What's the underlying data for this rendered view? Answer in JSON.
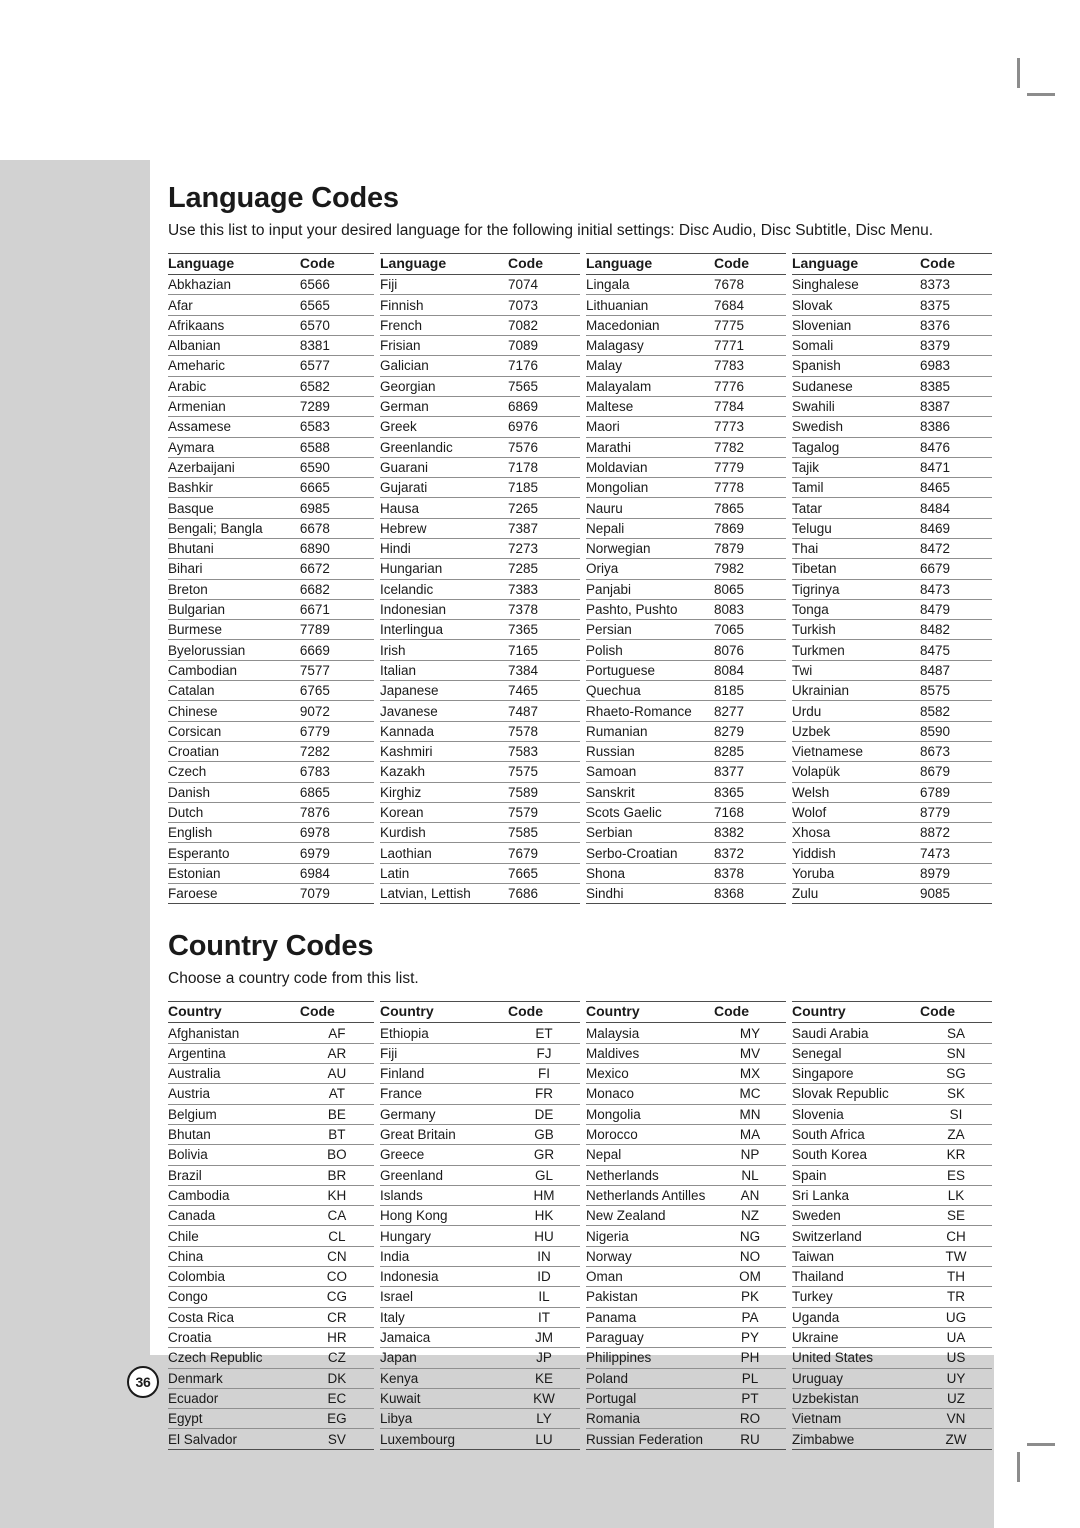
{
  "page": {
    "number": "36"
  },
  "language_section": {
    "title": "Language Codes",
    "intro": "Use this list to input your desired language for the following initial settings:\nDisc Audio, Disc Subtitle, Disc Menu.",
    "headers": {
      "name": "Language",
      "code": "Code"
    },
    "columns": [
      [
        [
          "Abkhazian",
          "6566"
        ],
        [
          "Afar",
          "6565"
        ],
        [
          "Afrikaans",
          "6570"
        ],
        [
          "Albanian",
          "8381"
        ],
        [
          "Ameharic",
          "6577"
        ],
        [
          "Arabic",
          "6582"
        ],
        [
          "Armenian",
          "7289"
        ],
        [
          "Assamese",
          "6583"
        ],
        [
          "Aymara",
          "6588"
        ],
        [
          "Azerbaijani",
          "6590"
        ],
        [
          "Bashkir",
          "6665"
        ],
        [
          "Basque",
          "6985"
        ],
        [
          "Bengali; Bangla",
          "6678"
        ],
        [
          "Bhutani",
          "6890"
        ],
        [
          "Bihari",
          "6672"
        ],
        [
          "Breton",
          "6682"
        ],
        [
          "Bulgarian",
          "6671"
        ],
        [
          "Burmese",
          "7789"
        ],
        [
          "Byelorussian",
          "6669"
        ],
        [
          "Cambodian",
          "7577"
        ],
        [
          "Catalan",
          "6765"
        ],
        [
          "Chinese",
          "9072"
        ],
        [
          "Corsican",
          "6779"
        ],
        [
          "Croatian",
          "7282"
        ],
        [
          "Czech",
          "6783"
        ],
        [
          "Danish",
          "6865"
        ],
        [
          "Dutch",
          "7876"
        ],
        [
          "English",
          "6978"
        ],
        [
          "Esperanto",
          "6979"
        ],
        [
          "Estonian",
          "6984"
        ],
        [
          "Faroese",
          "7079"
        ]
      ],
      [
        [
          "Fiji",
          "7074"
        ],
        [
          "Finnish",
          "7073"
        ],
        [
          "French",
          "7082"
        ],
        [
          "Frisian",
          "7089"
        ],
        [
          "Galician",
          "7176"
        ],
        [
          "Georgian",
          "7565"
        ],
        [
          "German",
          "6869"
        ],
        [
          "Greek",
          "6976"
        ],
        [
          "Greenlandic",
          "7576"
        ],
        [
          "Guarani",
          "7178"
        ],
        [
          "Gujarati",
          "7185"
        ],
        [
          "Hausa",
          "7265"
        ],
        [
          "Hebrew",
          "7387"
        ],
        [
          "Hindi",
          "7273"
        ],
        [
          "Hungarian",
          "7285"
        ],
        [
          "Icelandic",
          "7383"
        ],
        [
          "Indonesian",
          "7378"
        ],
        [
          "Interlingua",
          "7365"
        ],
        [
          "Irish",
          "7165"
        ],
        [
          "Italian",
          "7384"
        ],
        [
          "Japanese",
          "7465"
        ],
        [
          "Javanese",
          "7487"
        ],
        [
          "Kannada",
          "7578"
        ],
        [
          "Kashmiri",
          "7583"
        ],
        [
          "Kazakh",
          "7575"
        ],
        [
          "Kirghiz",
          "7589"
        ],
        [
          "Korean",
          "7579"
        ],
        [
          "Kurdish",
          "7585"
        ],
        [
          "Laothian",
          "7679"
        ],
        [
          "Latin",
          "7665"
        ],
        [
          "Latvian, Lettish",
          "7686"
        ]
      ],
      [
        [
          "Lingala",
          "7678"
        ],
        [
          "Lithuanian",
          "7684"
        ],
        [
          "Macedonian",
          "7775"
        ],
        [
          "Malagasy",
          "7771"
        ],
        [
          "Malay",
          "7783"
        ],
        [
          "Malayalam",
          "7776"
        ],
        [
          "Maltese",
          "7784"
        ],
        [
          "Maori",
          "7773"
        ],
        [
          "Marathi",
          "7782"
        ],
        [
          "Moldavian",
          "7779"
        ],
        [
          "Mongolian",
          "7778"
        ],
        [
          "Nauru",
          "7865"
        ],
        [
          "Nepali",
          "7869"
        ],
        [
          "Norwegian",
          "7879"
        ],
        [
          "Oriya",
          "7982"
        ],
        [
          "Panjabi",
          "8065"
        ],
        [
          "Pashto, Pushto",
          "8083"
        ],
        [
          "Persian",
          "7065"
        ],
        [
          "Polish",
          "8076"
        ],
        [
          "Portuguese",
          "8084"
        ],
        [
          "Quechua",
          "8185"
        ],
        [
          "Rhaeto-Romance",
          "8277"
        ],
        [
          "Rumanian",
          "8279"
        ],
        [
          "Russian",
          "8285"
        ],
        [
          "Samoan",
          "8377"
        ],
        [
          "Sanskrit",
          "8365"
        ],
        [
          "Scots Gaelic",
          "7168"
        ],
        [
          "Serbian",
          "8382"
        ],
        [
          "Serbo-Croatian",
          "8372"
        ],
        [
          "Shona",
          "8378"
        ],
        [
          "Sindhi",
          "8368"
        ]
      ],
      [
        [
          "Singhalese",
          "8373"
        ],
        [
          "Slovak",
          "8375"
        ],
        [
          "Slovenian",
          "8376"
        ],
        [
          "Somali",
          "8379"
        ],
        [
          "Spanish",
          "6983"
        ],
        [
          "Sudanese",
          "8385"
        ],
        [
          "Swahili",
          "8387"
        ],
        [
          "Swedish",
          "8386"
        ],
        [
          "Tagalog",
          "8476"
        ],
        [
          "Tajik",
          "8471"
        ],
        [
          "Tamil",
          "8465"
        ],
        [
          "Tatar",
          "8484"
        ],
        [
          "Telugu",
          "8469"
        ],
        [
          "Thai",
          "8472"
        ],
        [
          "Tibetan",
          "6679"
        ],
        [
          "Tigrinya",
          "8473"
        ],
        [
          "Tonga",
          "8479"
        ],
        [
          "Turkish",
          "8482"
        ],
        [
          "Turkmen",
          "8475"
        ],
        [
          "Twi",
          "8487"
        ],
        [
          "Ukrainian",
          "8575"
        ],
        [
          "Urdu",
          "8582"
        ],
        [
          "Uzbek",
          "8590"
        ],
        [
          "Vietnamese",
          "8673"
        ],
        [
          "Volapük",
          "8679"
        ],
        [
          "Welsh",
          "6789"
        ],
        [
          "Wolof",
          "8779"
        ],
        [
          "Xhosa",
          "8872"
        ],
        [
          "Yiddish",
          "7473"
        ],
        [
          "Yoruba",
          "8979"
        ],
        [
          "Zulu",
          "9085"
        ]
      ]
    ]
  },
  "country_section": {
    "title": "Country Codes",
    "intro": "Choose a country code from this list.",
    "headers": {
      "name": "Country",
      "code": "Code"
    },
    "columns": [
      [
        [
          "Afghanistan",
          "AF"
        ],
        [
          "Argentina",
          "AR"
        ],
        [
          "Australia",
          "AU"
        ],
        [
          "Austria",
          "AT"
        ],
        [
          "Belgium",
          "BE"
        ],
        [
          "Bhutan",
          "BT"
        ],
        [
          "Bolivia",
          "BO"
        ],
        [
          "Brazil",
          "BR"
        ],
        [
          "Cambodia",
          "KH"
        ],
        [
          "Canada",
          "CA"
        ],
        [
          "Chile",
          "CL"
        ],
        [
          "China",
          "CN"
        ],
        [
          "Colombia",
          "CO"
        ],
        [
          "Congo",
          "CG"
        ],
        [
          "Costa Rica",
          "CR"
        ],
        [
          "Croatia",
          "HR"
        ],
        [
          "Czech Republic",
          "CZ"
        ],
        [
          "Denmark",
          "DK"
        ],
        [
          "Ecuador",
          "EC"
        ],
        [
          "Egypt",
          "EG"
        ],
        [
          "El Salvador",
          "SV"
        ]
      ],
      [
        [
          "Ethiopia",
          "ET"
        ],
        [
          "Fiji",
          "FJ"
        ],
        [
          "Finland",
          "FI"
        ],
        [
          "France",
          "FR"
        ],
        [
          "Germany",
          "DE"
        ],
        [
          "Great Britain",
          "GB"
        ],
        [
          "Greece",
          "GR"
        ],
        [
          "Greenland",
          "GL"
        ],
        [
          "Islands",
          "HM"
        ],
        [
          "Hong Kong",
          "HK"
        ],
        [
          "Hungary",
          "HU"
        ],
        [
          "India",
          "IN"
        ],
        [
          "Indonesia",
          "ID"
        ],
        [
          "Israel",
          "IL"
        ],
        [
          "Italy",
          "IT"
        ],
        [
          "Jamaica",
          "JM"
        ],
        [
          "Japan",
          "JP"
        ],
        [
          "Kenya",
          "KE"
        ],
        [
          "Kuwait",
          "KW"
        ],
        [
          "Libya",
          "LY"
        ],
        [
          "Luxembourg",
          "LU"
        ]
      ],
      [
        [
          "Malaysia",
          "MY"
        ],
        [
          "Maldives",
          "MV"
        ],
        [
          "Mexico",
          "MX"
        ],
        [
          "Monaco",
          "MC"
        ],
        [
          "Mongolia",
          "MN"
        ],
        [
          "Morocco",
          "MA"
        ],
        [
          "Nepal",
          "NP"
        ],
        [
          "Netherlands",
          "NL"
        ],
        [
          "Netherlands Antilles",
          "AN"
        ],
        [
          "New Zealand",
          "NZ"
        ],
        [
          "Nigeria",
          "NG"
        ],
        [
          "Norway",
          "NO"
        ],
        [
          "Oman",
          "OM"
        ],
        [
          "Pakistan",
          "PK"
        ],
        [
          "Panama",
          "PA"
        ],
        [
          "Paraguay",
          "PY"
        ],
        [
          "Philippines",
          "PH"
        ],
        [
          "Poland",
          "PL"
        ],
        [
          "Portugal",
          "PT"
        ],
        [
          "Romania",
          "RO"
        ],
        [
          "Russian Federation",
          "RU"
        ]
      ],
      [
        [
          "Saudi Arabia",
          "SA"
        ],
        [
          "Senegal",
          "SN"
        ],
        [
          "Singapore",
          "SG"
        ],
        [
          "Slovak Republic",
          "SK"
        ],
        [
          "Slovenia",
          "SI"
        ],
        [
          "South Africa",
          "ZA"
        ],
        [
          "South Korea",
          "KR"
        ],
        [
          "Spain",
          "ES"
        ],
        [
          "Sri Lanka",
          "LK"
        ],
        [
          "Sweden",
          "SE"
        ],
        [
          "Switzerland",
          "CH"
        ],
        [
          "Taiwan",
          "TW"
        ],
        [
          "Thailand",
          "TH"
        ],
        [
          "Turkey",
          "TR"
        ],
        [
          "Uganda",
          "UG"
        ],
        [
          "Ukraine",
          "UA"
        ],
        [
          "United States",
          "US"
        ],
        [
          "Uruguay",
          "UY"
        ],
        [
          "Uzbekistan",
          "UZ"
        ],
        [
          "Vietnam",
          "VN"
        ],
        [
          "Zimbabwe",
          "ZW"
        ]
      ]
    ]
  },
  "colors": {
    "page_background": "#d2d2d2",
    "paper": "#ffffff",
    "text": "#1a1a1a",
    "rule_strong": "#4d4d4d",
    "rule_light": "#8f8f8f"
  }
}
